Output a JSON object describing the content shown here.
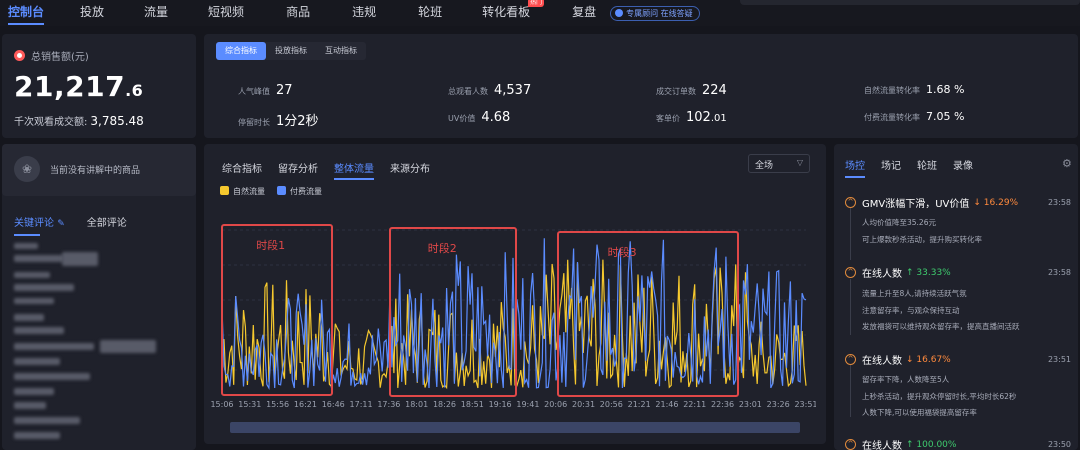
{
  "nav": {
    "items": [
      "控制台",
      "投放",
      "流量",
      "短视频",
      "商品",
      "违规",
      "轮班",
      "转化看板",
      "复盘"
    ],
    "hot_badge": "热门",
    "pill": "专属顾问 在线答疑"
  },
  "sales": {
    "title": "总销售额(元)",
    "value_int": "21,217",
    "value_dec": ".6",
    "gpm_label": "千次观看成交额:",
    "gpm_value": "3,785.48"
  },
  "metric_tabs": [
    "综合指标",
    "投放指标",
    "互动指标"
  ],
  "metrics": [
    {
      "label": "人气峰值",
      "value": "27"
    },
    {
      "label": "总观看人数",
      "value": "4,537"
    },
    {
      "label": "成交订单数",
      "value": "224"
    },
    {
      "label": "自然流量转化率",
      "value": "1.68 %"
    },
    {
      "label": "停留时长",
      "value": "1分2秒"
    },
    {
      "label": "UV价值",
      "value": "4.68"
    },
    {
      "label": "客单价",
      "value_int": "102",
      "value_dec": ".01"
    },
    {
      "label": "付费流量转化率",
      "value": "7.05 %"
    }
  ],
  "left_panel": {
    "no_product": "当前没有讲解中的商品",
    "tab_key": "关键评论",
    "tab_all": "全部评论"
  },
  "chart_tabs": [
    "综合指标",
    "留存分析",
    "整体流量",
    "来源分布"
  ],
  "chart_select": "全场",
  "chart_data": {
    "type": "line",
    "x": [
      "15:06",
      "15:31",
      "15:56",
      "16:21",
      "16:46",
      "17:11",
      "17:36",
      "18:01",
      "18:26",
      "18:51",
      "19:16",
      "19:41",
      "20:06",
      "20:31",
      "20:56",
      "21:21",
      "21:46",
      "22:11",
      "22:36",
      "23:01",
      "23:26",
      "23:51"
    ],
    "series": [
      {
        "name": "自然流量",
        "color": "#f5c82e"
      },
      {
        "name": "付费流量",
        "color": "#5b8cff"
      }
    ],
    "annotations": [
      "时段1",
      "时段2",
      "时段3"
    ]
  },
  "right_panel": {
    "tabs": [
      "场控",
      "场记",
      "轮班",
      "录像"
    ],
    "events": [
      {
        "title": "GMV涨幅下滑，UV价值",
        "delta": "↓ 16.29%",
        "dir": "down",
        "time": "23:58",
        "lines": [
          "人均价值降至35.26元",
          "可上爆款秒杀活动，提升购买转化率"
        ]
      },
      {
        "title": "在线人数",
        "delta": "↑ 33.33%",
        "dir": "up",
        "time": "23:58",
        "lines": [
          "流量上升至8人,请持续活跃气氛",
          "注意留存率，与观众保持互动",
          "发放福袋可以维持观众留存率，提高直播间活跃"
        ]
      },
      {
        "title": "在线人数",
        "delta": "↓ 16.67%",
        "dir": "down",
        "time": "23:51",
        "lines": [
          "留存率下降，人数降至5人",
          "上秒杀活动，提升观众停留时长,平均时长62秒",
          "人数下降,可以使用福袋提高留存率"
        ]
      },
      {
        "title": "在线人数",
        "delta": "↑ 100.00%",
        "dir": "up",
        "time": "23:50",
        "lines": []
      }
    ]
  }
}
